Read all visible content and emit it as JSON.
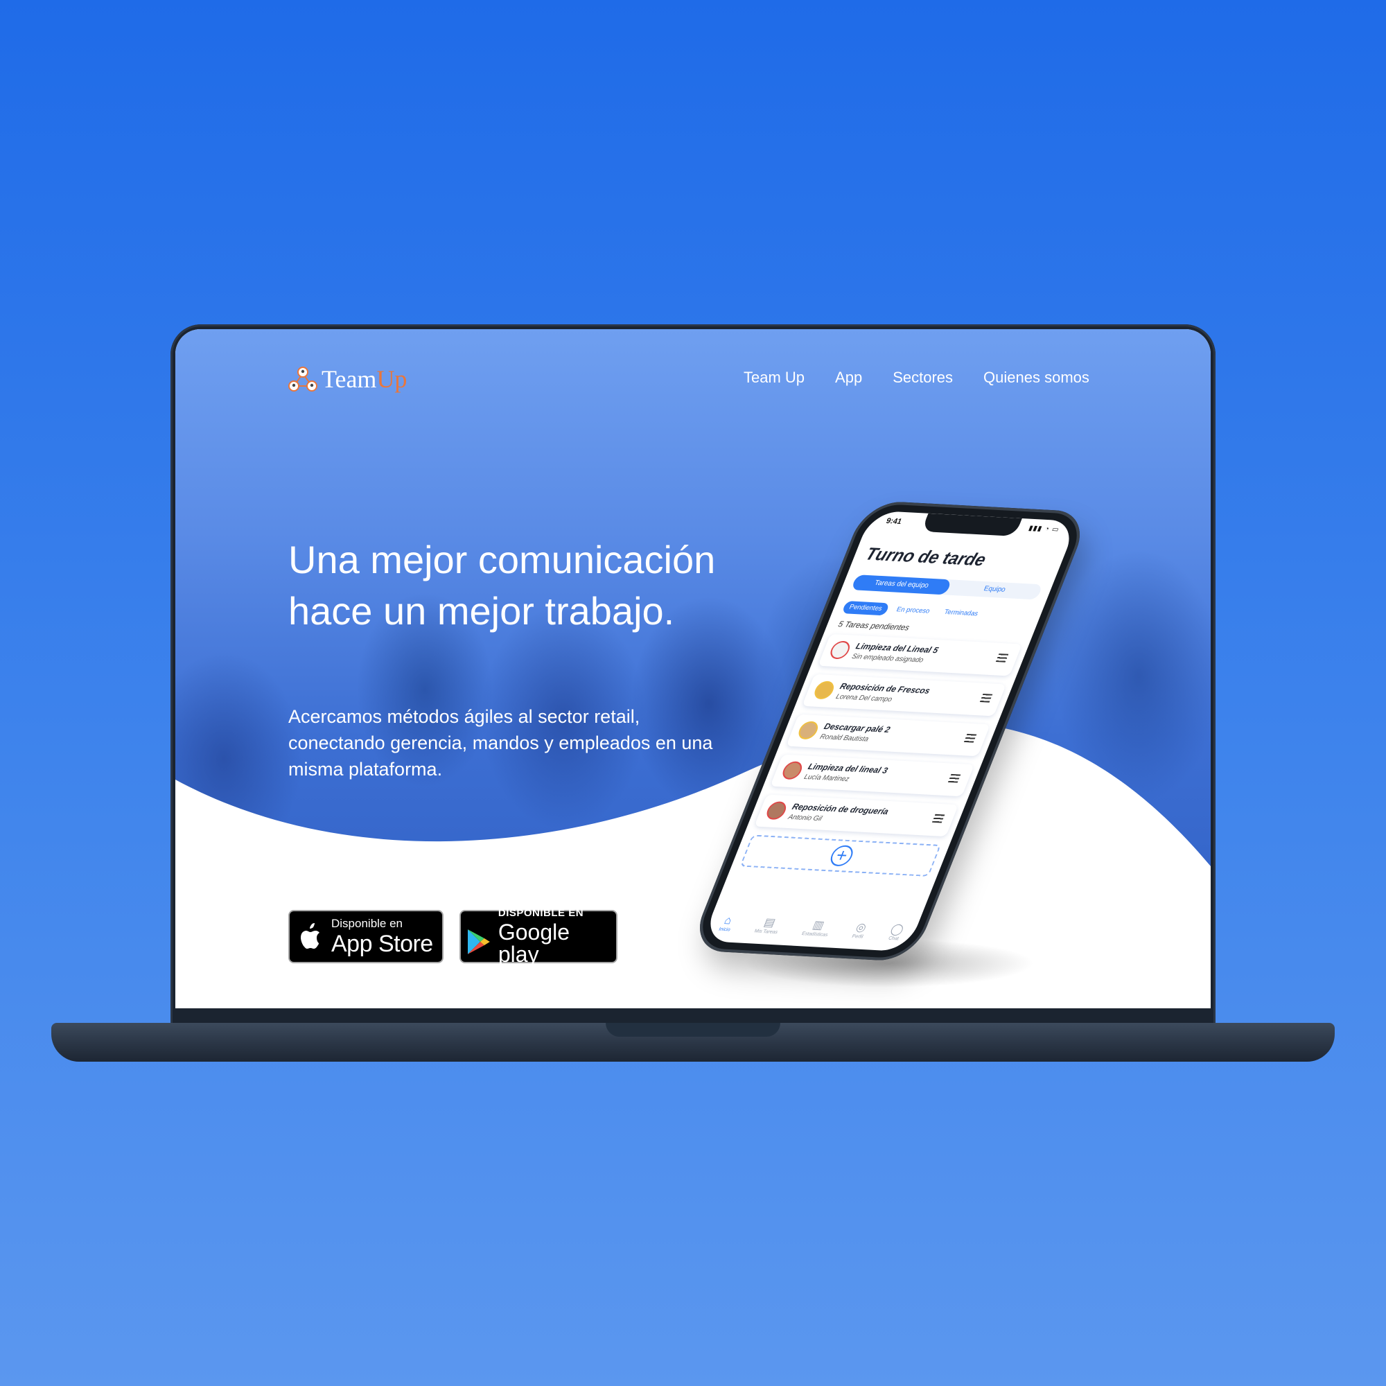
{
  "brand": {
    "name_part1": "Team",
    "name_part2": "Up",
    "accent": "#e8763c"
  },
  "nav": {
    "items": [
      "Team Up",
      "App",
      "Sectores",
      "Quienes somos"
    ]
  },
  "hero": {
    "headline": "Una mejor comunicación hace un mejor trabajo.",
    "subtext": "Acercamos métodos ágiles al sector retail, conectando gerencia, mandos y empleados en una misma plataforma."
  },
  "badges": {
    "appstore": {
      "small": "Disponible en",
      "big": "App Store",
      "icon": "apple-icon"
    },
    "google": {
      "small": "DISPONIBLE EN",
      "big": "Google play",
      "icon": "google-play-icon"
    }
  },
  "phone": {
    "time": "9:41",
    "title": "Turno de tarde",
    "segments": [
      "Tareas del equipo",
      "Equipo"
    ],
    "tabs": [
      "Pendientes",
      "En proceso",
      "Terminadas"
    ],
    "count": "5 Tareas pendientes",
    "tasks": [
      {
        "name": "Limpieza del Lineal 5",
        "assignee": "Sin empleado asignado"
      },
      {
        "name": "Reposición de Frescos",
        "assignee": "Lorena Del campo"
      },
      {
        "name": "Descargar palé 2",
        "assignee": "Ronald Bautista"
      },
      {
        "name": "Limpieza del lineal 3",
        "assignee": "Lucía Martinez"
      },
      {
        "name": "Reposición de droguería",
        "assignee": "Antonio Gil"
      }
    ],
    "bottom_nav": [
      "Inicio",
      "Mis Tareas",
      "Estadísticas",
      "Perfil",
      "Chat"
    ],
    "accent": "#2f7cf6"
  },
  "colors": {
    "background": "#2a74ea",
    "hero_blue": "#3d6fd3"
  }
}
